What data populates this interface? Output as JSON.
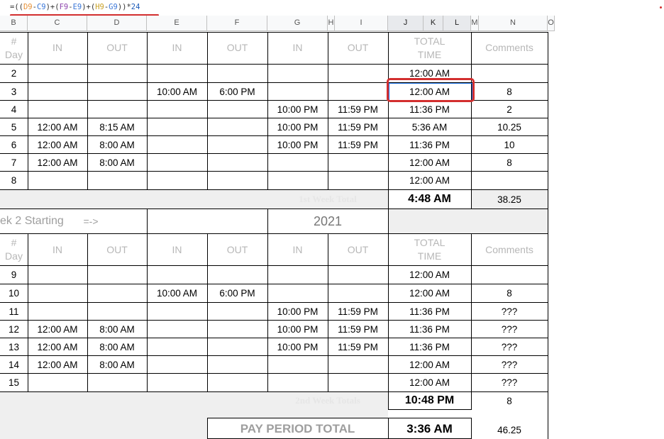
{
  "formula_bar": {
    "parts": [
      "=((",
      "D9",
      "-",
      "C9",
      ")+(",
      "F9",
      "-",
      "E9",
      ")+(",
      "H9",
      "-",
      "G9",
      "))*",
      "24"
    ]
  },
  "columns": [
    "B",
    "C",
    "D",
    "E",
    "F",
    "G",
    "H",
    "I",
    "J",
    "K",
    "L",
    "M",
    "N",
    "O"
  ],
  "table_header": {
    "day_line1": "#",
    "day_line2": "Day",
    "in": "IN",
    "out": "OUT",
    "total_line1": "TOTAL",
    "total_line2": "TIME",
    "comments": "Comments"
  },
  "week1_rows": [
    {
      "day": "2",
      "c": "",
      "d": "",
      "e": "",
      "f": "",
      "g": "",
      "i": "",
      "total": "12:00 AM",
      "comment": ""
    },
    {
      "day": "3",
      "c": "",
      "d": "",
      "e": "10:00 AM",
      "f": "6:00 PM",
      "g": "",
      "i": "",
      "total": "12:00 AM",
      "comment": "8"
    },
    {
      "day": "4",
      "c": "",
      "d": "",
      "e": "",
      "f": "",
      "g": "10:00 PM",
      "i": "11:59 PM",
      "total": "11:36 PM",
      "comment": "2"
    },
    {
      "day": "5",
      "c": "12:00 AM",
      "d": "8:15 AM",
      "e": "",
      "f": "",
      "g": "10:00 PM",
      "i": "11:59 PM",
      "total": "5:36 AM",
      "comment": "10.25"
    },
    {
      "day": "6",
      "c": "12:00 AM",
      "d": "8:00 AM",
      "e": "",
      "f": "",
      "g": "10:00 PM",
      "i": "11:59 PM",
      "total": "11:36 PM",
      "comment": "10"
    },
    {
      "day": "7",
      "c": "12:00 AM",
      "d": "8:00 AM",
      "e": "",
      "f": "",
      "g": "",
      "i": "",
      "total": "12:00 AM",
      "comment": "8"
    },
    {
      "day": "8",
      "c": "",
      "d": "",
      "e": "",
      "f": "",
      "g": "",
      "i": "",
      "total": "12:00 AM",
      "comment": ""
    }
  ],
  "week1_total": {
    "label": "1st Week Total",
    "value": "4:48 AM",
    "comment": "38.25"
  },
  "week2_banner": {
    "label": "ek 2 Starting",
    "arrow": "=->",
    "year": "2021"
  },
  "week2_rows": [
    {
      "day": "9",
      "c": "",
      "d": "",
      "e": "",
      "f": "",
      "g": "",
      "i": "",
      "total": "12:00 AM",
      "comment": ""
    },
    {
      "day": "10",
      "c": "",
      "d": "",
      "e": "10:00 AM",
      "f": "6:00 PM",
      "g": "",
      "i": "",
      "total": "12:00 AM",
      "comment": "8"
    },
    {
      "day": "11",
      "c": "",
      "d": "",
      "e": "",
      "f": "",
      "g": "10:00 PM",
      "i": "11:59 PM",
      "total": "11:36 PM",
      "comment": "???"
    },
    {
      "day": "12",
      "c": "12:00 AM",
      "d": "8:00 AM",
      "e": "",
      "f": "",
      "g": "10:00 PM",
      "i": "11:59 PM",
      "total": "11:36 PM",
      "comment": "???"
    },
    {
      "day": "13",
      "c": "12:00 AM",
      "d": "8:00 AM",
      "e": "",
      "f": "",
      "g": "10:00 PM",
      "i": "11:59 PM",
      "total": "11:36 PM",
      "comment": "???"
    },
    {
      "day": "14",
      "c": "12:00 AM",
      "d": "8:00 AM",
      "e": "",
      "f": "",
      "g": "",
      "i": "",
      "total": "12:00 AM",
      "comment": "???"
    },
    {
      "day": "15",
      "c": "",
      "d": "",
      "e": "",
      "f": "",
      "g": "",
      "i": "",
      "total": "12:00 AM",
      "comment": "???"
    }
  ],
  "week2_total": {
    "label": "2nd Week Totals",
    "value": "10:48 PM",
    "comment": "8"
  },
  "pay_period": {
    "label": "PAY PERIOD TOTAL",
    "value": "3:36 AM",
    "comment": "46.25"
  },
  "colors": {
    "highlight_red": "#d32f2f",
    "selection_blue": "#1a73e8",
    "header_gray": "#b7b7b7",
    "total_bg": "#efefef"
  }
}
